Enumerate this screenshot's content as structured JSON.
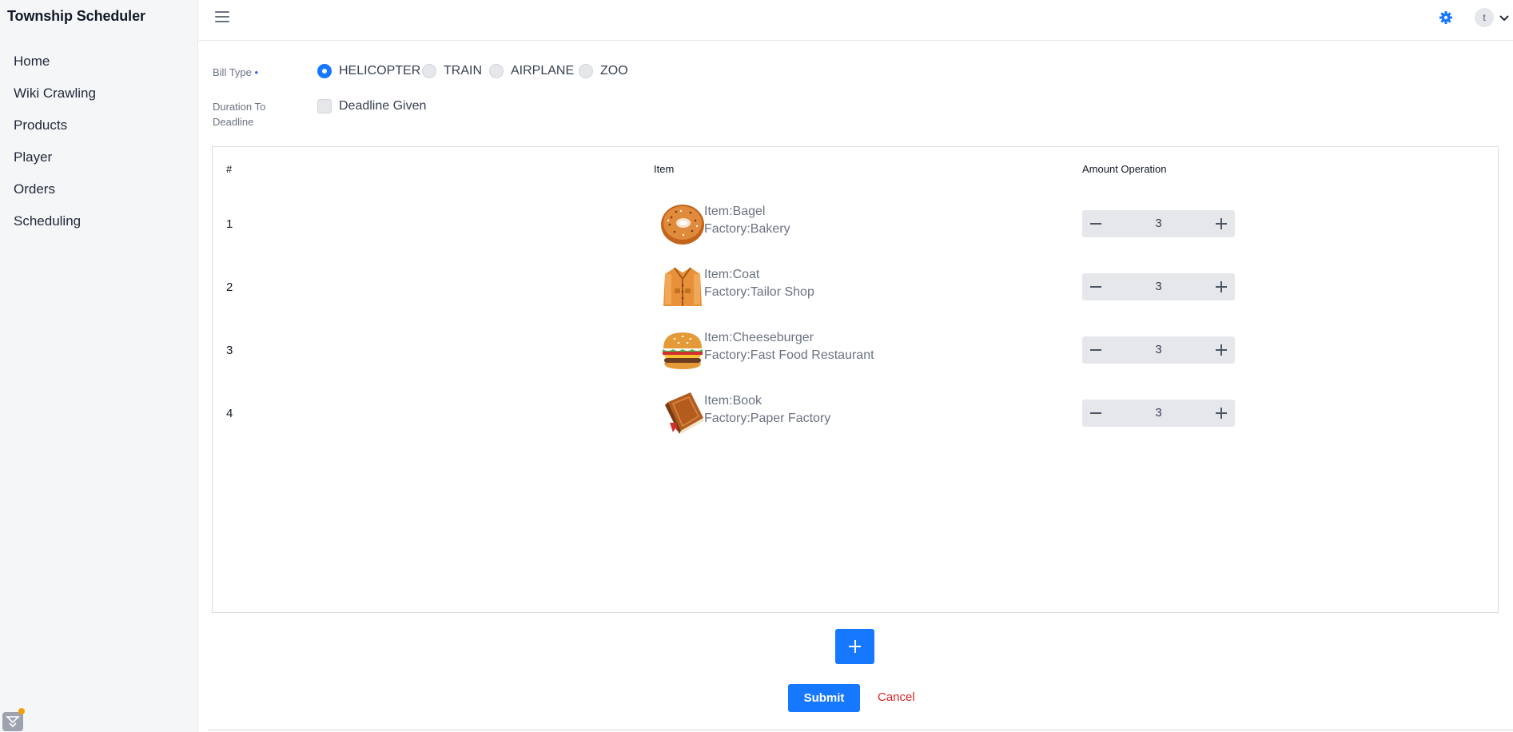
{
  "app": {
    "title": "Township Scheduler"
  },
  "sidebar": {
    "items": [
      {
        "label": "Home"
      },
      {
        "label": "Wiki Crawling"
      },
      {
        "label": "Products"
      },
      {
        "label": "Player"
      },
      {
        "label": "Orders"
      },
      {
        "label": "Scheduling"
      }
    ]
  },
  "header": {
    "avatar_initial": "t",
    "icons": [
      "menu-icon",
      "gear-icon",
      "chevron-down-icon"
    ],
    "accent_color": "#1677ff"
  },
  "form": {
    "bill_type_label": "Bill Type",
    "bill_type_required_mark": "•",
    "bill_types": [
      {
        "label": "HELICOPTER",
        "checked": true
      },
      {
        "label": "TRAIN",
        "checked": false
      },
      {
        "label": "AIRPLANE",
        "checked": false
      },
      {
        "label": "ZOO",
        "checked": false
      }
    ],
    "duration_label_line1": "Duration To",
    "duration_label_line2": "Deadline",
    "deadline_checkbox_label": "Deadline Given",
    "deadline_checked": false
  },
  "table": {
    "columns": [
      "#",
      "Item",
      "Amount Operation"
    ],
    "rows": [
      {
        "num": "1",
        "item": "Item:Bagel",
        "factory": "Factory:Bakery",
        "amount": "3",
        "icon": "bagel-icon"
      },
      {
        "num": "2",
        "item": "Item:Coat",
        "factory": "Factory:Tailor Shop",
        "amount": "3",
        "icon": "coat-icon"
      },
      {
        "num": "3",
        "item": "Item:Cheeseburger",
        "factory": "Factory:Fast Food Restaurant",
        "amount": "3",
        "icon": "cheeseburger-icon"
      },
      {
        "num": "4",
        "item": "Item:Book",
        "factory": "Factory:Paper Factory",
        "amount": "3",
        "icon": "book-icon"
      }
    ]
  },
  "actions": {
    "submit_label": "Submit",
    "cancel_label": "Cancel",
    "cancel_color": "#dc2626"
  }
}
